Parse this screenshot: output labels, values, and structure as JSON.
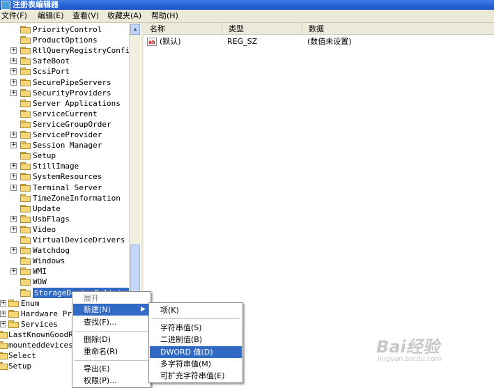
{
  "window": {
    "title": "注册表编辑器"
  },
  "menubar": [
    "文件(F)",
    "编辑(E)",
    "查看(V)",
    "收藏夹(A)",
    "帮助(H)"
  ],
  "columns": {
    "name": "名称",
    "type": "类型",
    "data": "数据"
  },
  "values": [
    {
      "name": "(默认)",
      "type": "REG_SZ",
      "data": "(数值未设置)"
    }
  ],
  "tree": {
    "items": [
      {
        "label": "PriorityControl",
        "expandable": false
      },
      {
        "label": "ProductOptions",
        "expandable": false
      },
      {
        "label": "RtlQueryRegistryConfig",
        "expandable": true
      },
      {
        "label": "SafeBoot",
        "expandable": true
      },
      {
        "label": "ScsiPort",
        "expandable": true
      },
      {
        "label": "SecurePipeServers",
        "expandable": true
      },
      {
        "label": "SecurityProviders",
        "expandable": true
      },
      {
        "label": "Server Applications",
        "expandable": false
      },
      {
        "label": "ServiceCurrent",
        "expandable": false
      },
      {
        "label": "ServiceGroupOrder",
        "expandable": false
      },
      {
        "label": "ServiceProvider",
        "expandable": true
      },
      {
        "label": "Session Manager",
        "expandable": true
      },
      {
        "label": "Setup",
        "expandable": false
      },
      {
        "label": "StillImage",
        "expandable": true
      },
      {
        "label": "SystemResources",
        "expandable": true
      },
      {
        "label": "Terminal Server",
        "expandable": true
      },
      {
        "label": "TimeZoneInformation",
        "expandable": false
      },
      {
        "label": "Update",
        "expandable": false
      },
      {
        "label": "UsbFlags",
        "expandable": true
      },
      {
        "label": "Video",
        "expandable": true
      },
      {
        "label": "VirtualDeviceDrivers",
        "expandable": false
      },
      {
        "label": "Watchdog",
        "expandable": true
      },
      {
        "label": "Windows",
        "expandable": false
      },
      {
        "label": "WMI",
        "expandable": true
      },
      {
        "label": "WOW",
        "expandable": false
      },
      {
        "label": "StorageDevicePolicies",
        "expandable": false,
        "selected": true
      }
    ],
    "level2": [
      {
        "label": "Enum",
        "expandable": true
      },
      {
        "label": "Hardware Profiles",
        "expandable": true
      },
      {
        "label": "Services",
        "expandable": true
      }
    ],
    "level1": [
      {
        "label": "LastKnownGoodRecovery"
      },
      {
        "label": "mounteddevices"
      },
      {
        "label": "Select"
      },
      {
        "label": "Setup"
      }
    ]
  },
  "context_menu": {
    "expand": "展开",
    "new": "新建(N)",
    "find": "查找(F)...",
    "delete": "删除(D)",
    "rename": "重命名(R)",
    "export": "导出(E)",
    "permissions": "权限(P)..."
  },
  "submenu": {
    "key": "项(K)",
    "string": "字符串值(S)",
    "binary": "二进制值(B)",
    "dword": "DWORD 值(D)",
    "multi_string": "多字符串值(M)",
    "expand_string": "可扩充字符串值(E)"
  },
  "watermark": {
    "brand": "Bai经验",
    "url": "jingyan.baidu.com"
  }
}
